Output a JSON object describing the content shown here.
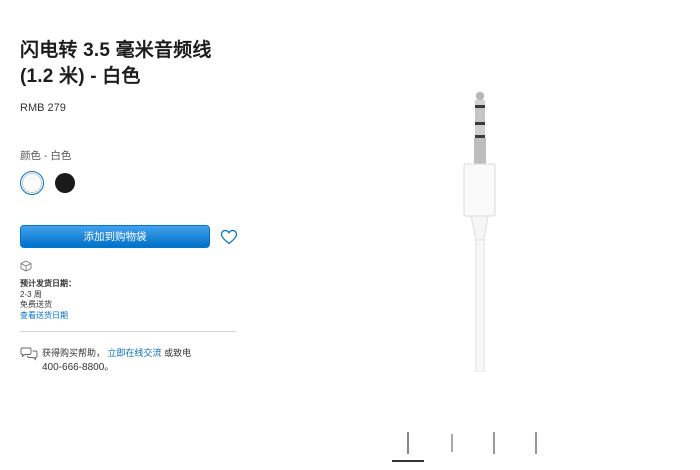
{
  "product": {
    "title_line1": "闪电转 3.5 毫米音频线",
    "title_line2": "(1.2 米) - 白色",
    "price": "RMB 279"
  },
  "color": {
    "label": "颜色 - 白色",
    "options": [
      "white",
      "black"
    ],
    "selected": "white"
  },
  "cart": {
    "add_label": "添加到购物袋"
  },
  "shipping": {
    "label": "预计发货日期：",
    "time": "2-3 周",
    "free": "免费送货",
    "link": "查看送货日期"
  },
  "help": {
    "prefix": "获得购买帮助，",
    "chat_link": "立即在线交流",
    "suffix": "或致电",
    "phone": "400-666-8800。"
  },
  "icons": {
    "favorite": "heart-icon",
    "shipping": "box-icon",
    "chat": "chat-bubbles-icon"
  },
  "colors": {
    "accent": "#0070c9",
    "text": "#1d1d1f"
  }
}
